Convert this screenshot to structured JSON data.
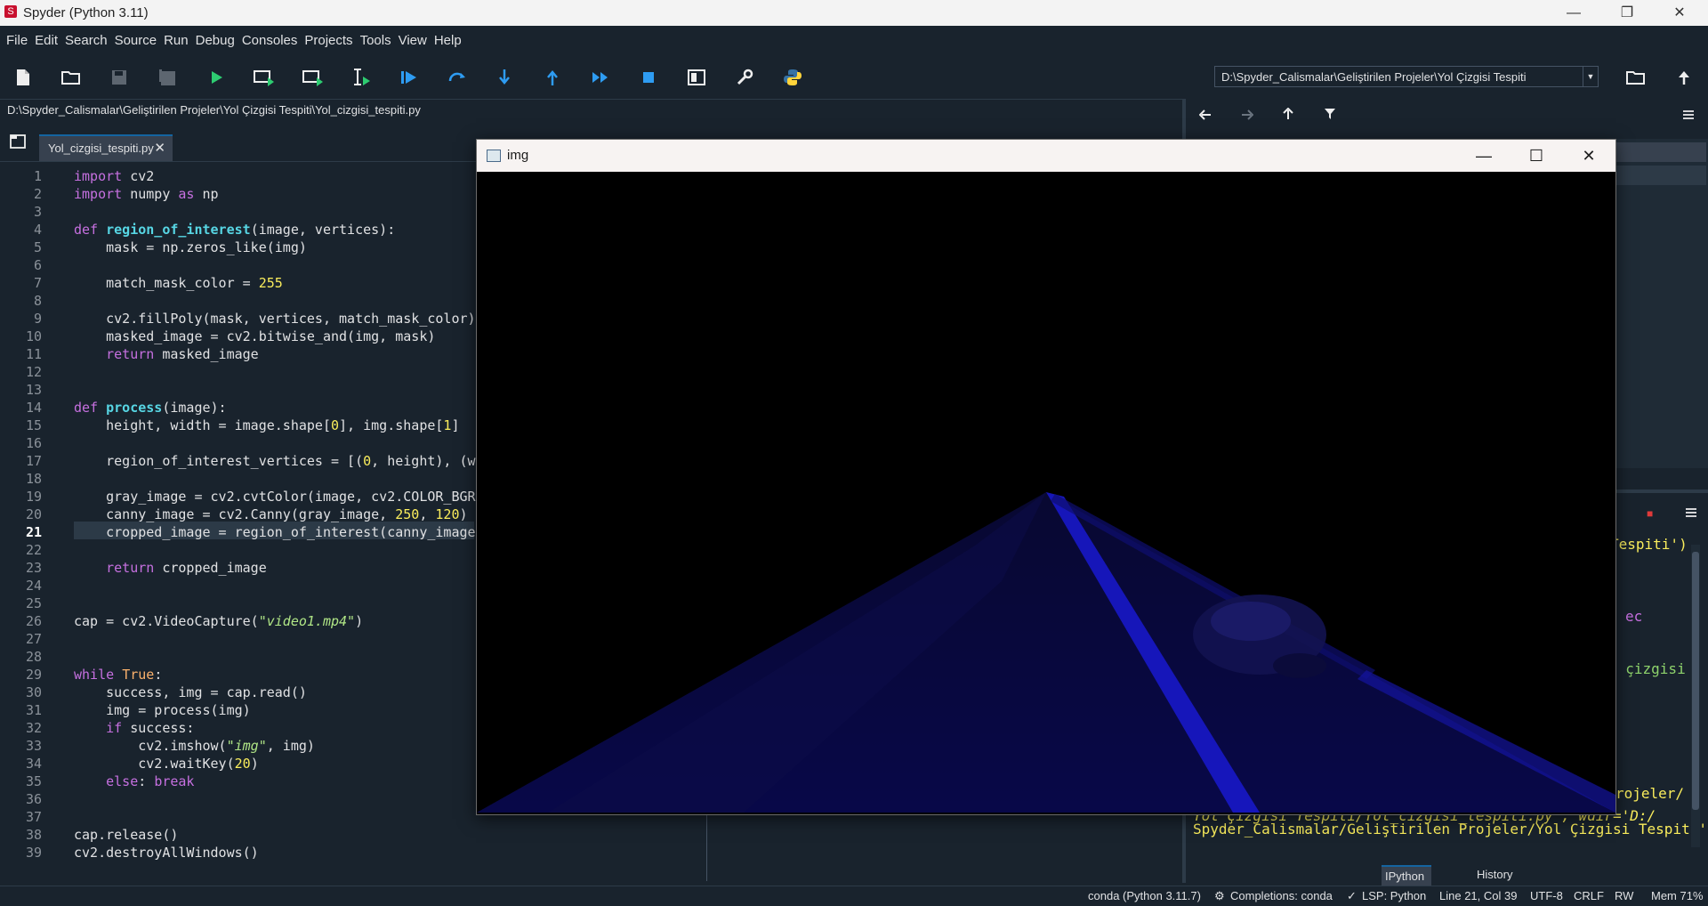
{
  "window": {
    "title": "Spyder (Python 3.11)",
    "minimize": "—",
    "maximize": "❐",
    "close": "✕"
  },
  "menu": [
    "File",
    "Edit",
    "Search",
    "Source",
    "Run",
    "Debug",
    "Consoles",
    "Projects",
    "Tools",
    "View",
    "Help"
  ],
  "toolbar": {
    "working_directory": "D:\\Spyder_Calismalar\\Geliştirilen Projeler\\Yol Çizgisi Tespiti"
  },
  "editor": {
    "file_path": "D:\\Spyder_Calismalar\\Geliştirilen Projeler\\Yol Çizgisi Tespiti\\Yol_cizgisi_tespiti.py",
    "tab_label": "Yol_cizgisi_tespiti.py",
    "current_line": 21
  },
  "img_window": {
    "title": "img"
  },
  "console": {
    "lines": [
      {
        "text": "Tespiti')",
        "color": "yellow"
      },
      {
        "text": "ec",
        "color": "purple"
      },
      {
        "text": "l çizgisi",
        "color": "green"
      },
      {
        "text": "rojeler/",
        "color": "yellow"
      },
      {
        "text": "Yol Çizgisi Tespiti/Yol_cizgisi_tespiti.py', wdir='D:/",
        "color": "yellow"
      },
      {
        "text": "Spyder_Calismalar/Geliştirilen Projeler/Yol Çizgisi Tespiti')",
        "color": "yellow"
      }
    ],
    "tabs": [
      "IPython Console",
      "History"
    ]
  },
  "status": {
    "env": "conda (Python 3.11.7)",
    "completions": "Completions: conda",
    "lsp": "LSP: Python",
    "position": "Line 21, Col 39",
    "encoding": "UTF-8",
    "eol": "CRLF",
    "rw": "RW",
    "mem": "Mem 71%"
  },
  "colors": {
    "background": "#19232d",
    "accent": "#2e9cf2",
    "keyword": "#c670e0",
    "function": "#57d6e4",
    "number": "#faed5c",
    "string": "#b0e686"
  }
}
